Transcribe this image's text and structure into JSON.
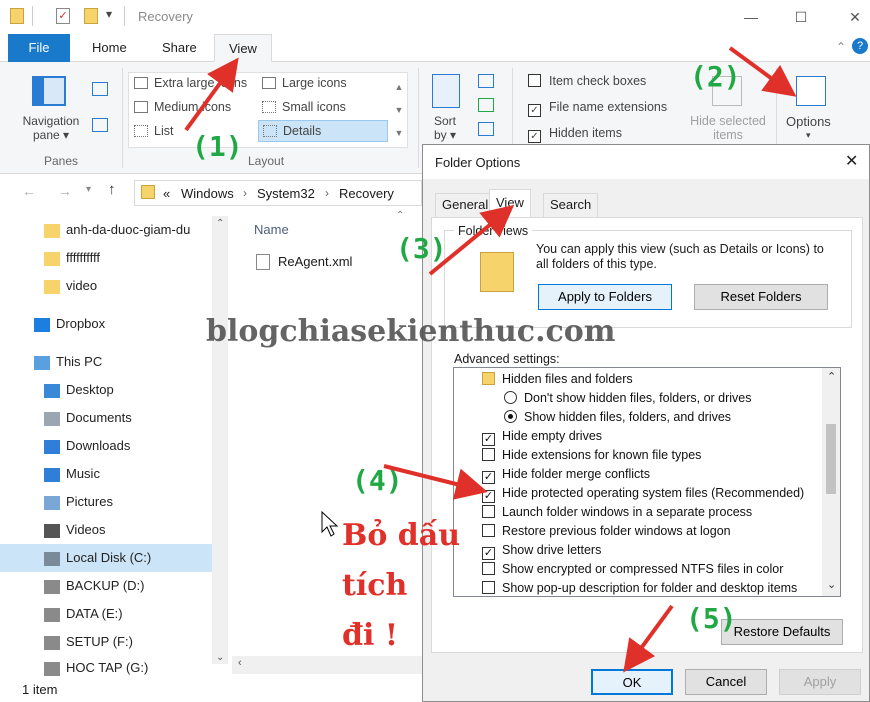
{
  "window": {
    "title": "Recovery"
  },
  "ribbon": {
    "tabs": [
      "File",
      "Home",
      "Share",
      "View"
    ],
    "panes": {
      "nav_pane": "Navigation pane ▾",
      "group": "Panes"
    },
    "layout": {
      "items": [
        "Extra large icons",
        "Large icons",
        "Medium icons",
        "Small icons",
        "List",
        "Details"
      ],
      "group": "Layout"
    },
    "sort_by": "Sort by ▾",
    "show_hide": {
      "item_check_boxes": "Item check boxes",
      "file_name_extensions": "File name extensions",
      "hidden_items": "Hidden items",
      "hide_selected": "Hide selected items"
    },
    "options": "Options"
  },
  "address": {
    "path": [
      "«",
      "Windows",
      "System32",
      "Recovery"
    ]
  },
  "nav": {
    "items": [
      {
        "label": "anh-da-duoc-giam-du",
        "type": "folder"
      },
      {
        "label": "ffffffffff",
        "type": "folder"
      },
      {
        "label": "video",
        "type": "folder"
      },
      {
        "label": "Dropbox",
        "type": "dropbox"
      },
      {
        "label": "This PC",
        "type": "pc"
      },
      {
        "label": "Desktop",
        "type": "desktop"
      },
      {
        "label": "Documents",
        "type": "docs"
      },
      {
        "label": "Downloads",
        "type": "down"
      },
      {
        "label": "Music",
        "type": "music"
      },
      {
        "label": "Pictures",
        "type": "pics"
      },
      {
        "label": "Videos",
        "type": "videos"
      },
      {
        "label": "Local Disk (C:)",
        "type": "disk",
        "selected": true
      },
      {
        "label": "BACKUP (D:)",
        "type": "drive"
      },
      {
        "label": "DATA (E:)",
        "type": "drive"
      },
      {
        "label": "SETUP (F:)",
        "type": "drive"
      },
      {
        "label": "HOC TAP (G:)",
        "type": "drive"
      }
    ]
  },
  "content": {
    "column_name": "Name",
    "files": [
      "ReAgent.xml"
    ]
  },
  "status": {
    "items": "1 item"
  },
  "dialog": {
    "title": "Folder Options",
    "tabs": [
      "General",
      "View",
      "Search"
    ],
    "folder_views": {
      "legend": "Folder views",
      "text": "You can apply this view (such as Details or Icons) to all folders of this type.",
      "apply": "Apply to Folders",
      "reset": "Reset Folders"
    },
    "advanced_label": "Advanced settings:",
    "advanced": [
      {
        "label": "Hidden files and folders",
        "kind": "folder",
        "indent": 0
      },
      {
        "label": "Don't show hidden files, folders, or drives",
        "kind": "radio",
        "on": false,
        "indent": 1
      },
      {
        "label": "Show hidden files, folders, and drives",
        "kind": "radio",
        "on": true,
        "indent": 1
      },
      {
        "label": "Hide empty drives",
        "kind": "check",
        "on": true,
        "indent": 0
      },
      {
        "label": "Hide extensions for known file types",
        "kind": "check",
        "on": false,
        "indent": 0
      },
      {
        "label": "Hide folder merge conflicts",
        "kind": "check",
        "on": true,
        "indent": 0
      },
      {
        "label": "Hide protected operating system files (Recommended)",
        "kind": "check",
        "on": true,
        "indent": 0
      },
      {
        "label": "Launch folder windows in a separate process",
        "kind": "check",
        "on": false,
        "indent": 0
      },
      {
        "label": "Restore previous folder windows at logon",
        "kind": "check",
        "on": false,
        "indent": 0
      },
      {
        "label": "Show drive letters",
        "kind": "check",
        "on": true,
        "indent": 0
      },
      {
        "label": "Show encrypted or compressed NTFS files in color",
        "kind": "check",
        "on": false,
        "indent": 0
      },
      {
        "label": "Show pop-up description for folder and desktop items",
        "kind": "check",
        "on": false,
        "indent": 0
      }
    ],
    "restore_defaults": "Restore Defaults",
    "ok": "OK",
    "cancel": "Cancel",
    "apply": "Apply"
  },
  "annotations": {
    "step1": "(1)",
    "step2": "(2)",
    "step3": "(3)",
    "step4": "(4)",
    "step5": "(5)",
    "note_line1": "Bỏ dấu",
    "note_line2": "tích",
    "note_line3": "đi !",
    "watermark": "blogchiasekienthuc.com"
  },
  "colors": {
    "accent": "#1979ca",
    "annotation_green": "#1fa843",
    "annotation_red": "#e0302a",
    "selected": "#cce4f7"
  }
}
